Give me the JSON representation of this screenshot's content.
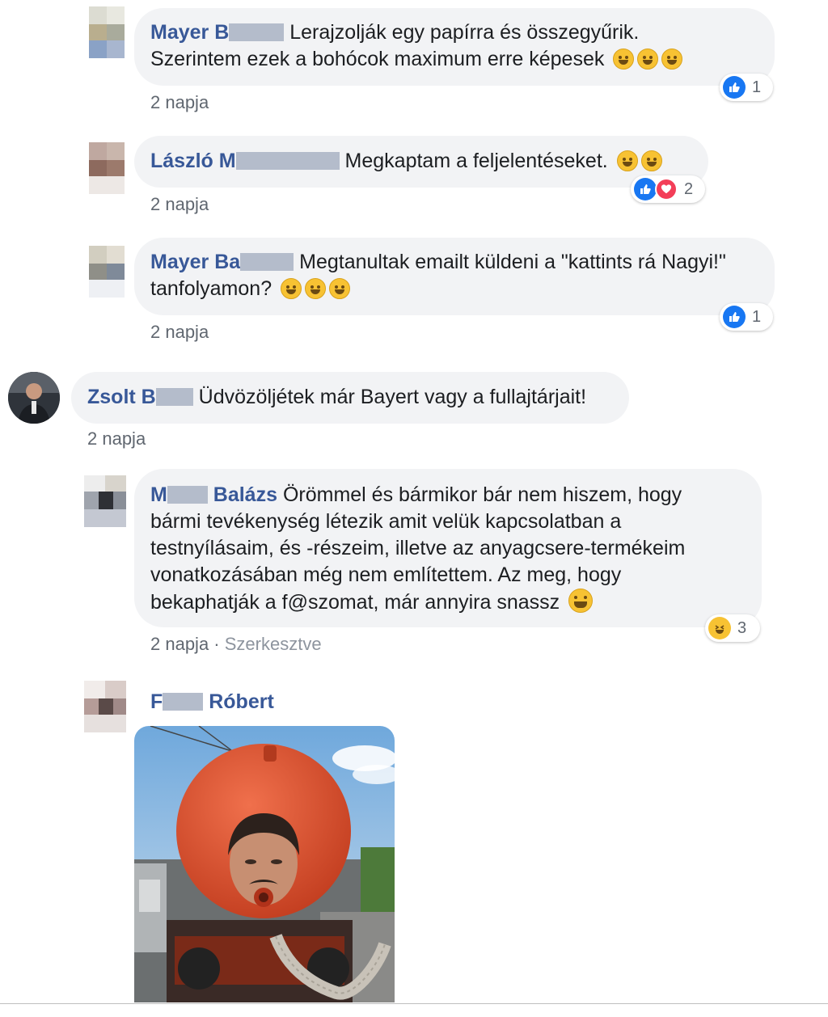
{
  "comments": [
    {
      "author_visible": "Mayer B",
      "text_line1": "Lerajzolják egy papírra és összegyűrik.",
      "text_line2": "Szerintem ezek a bohócok maximum erre képesek",
      "emoji_name": "rofl-emoji",
      "time": "2 napja",
      "reaction_count": "1"
    },
    {
      "author_visible": "László M",
      "text_line1": "Megkaptam a feljelentéseket.",
      "emoji_name": "nerd-emoji",
      "time": "2 napja",
      "reaction_count": "2"
    },
    {
      "author_visible": "Mayer Ba",
      "text_line1": "Megtanultak emailt küldeni a \"kattints rá Nagyi!\"",
      "text_line2": "tanfolyamon?",
      "emoji_name": "rofl-emoji",
      "time": "2 napja",
      "reaction_count": "1"
    },
    {
      "author_visible": "Zsolt B",
      "text_line1": "Üdvözöljétek már Bayert vagy a fullajtárjait!",
      "time": "2 napja"
    },
    {
      "author_first": "M",
      "author_last": "Balázs",
      "text_line1": "Örömmel és bármikor bár nem hiszem, hogy",
      "text_line2": "bármi tevékenység létezik amit velük kapcsolatban a",
      "text_line3": "testnyílásaim, és -részeim, illetve az anyagcsere-termékeim",
      "text_line4": "vonatkozásában még nem említettem. Az meg, hogy",
      "text_line5": "bekaphatják a f@szomat, már annyira snassz",
      "emoji_name": "grin-emoji",
      "time": "2 napja",
      "edited": "Szerkesztve",
      "reaction_count": "3"
    },
    {
      "author_first": "F",
      "author_last": "Róbert",
      "image_name": "meme-photo"
    }
  ],
  "colors": {
    "author": "#385898",
    "bubble": "#f2f3f5",
    "meta": "#606770",
    "like": "#1877f2",
    "love": "#f33e58",
    "haha": "#f7c233",
    "tank": "#e0502c"
  }
}
